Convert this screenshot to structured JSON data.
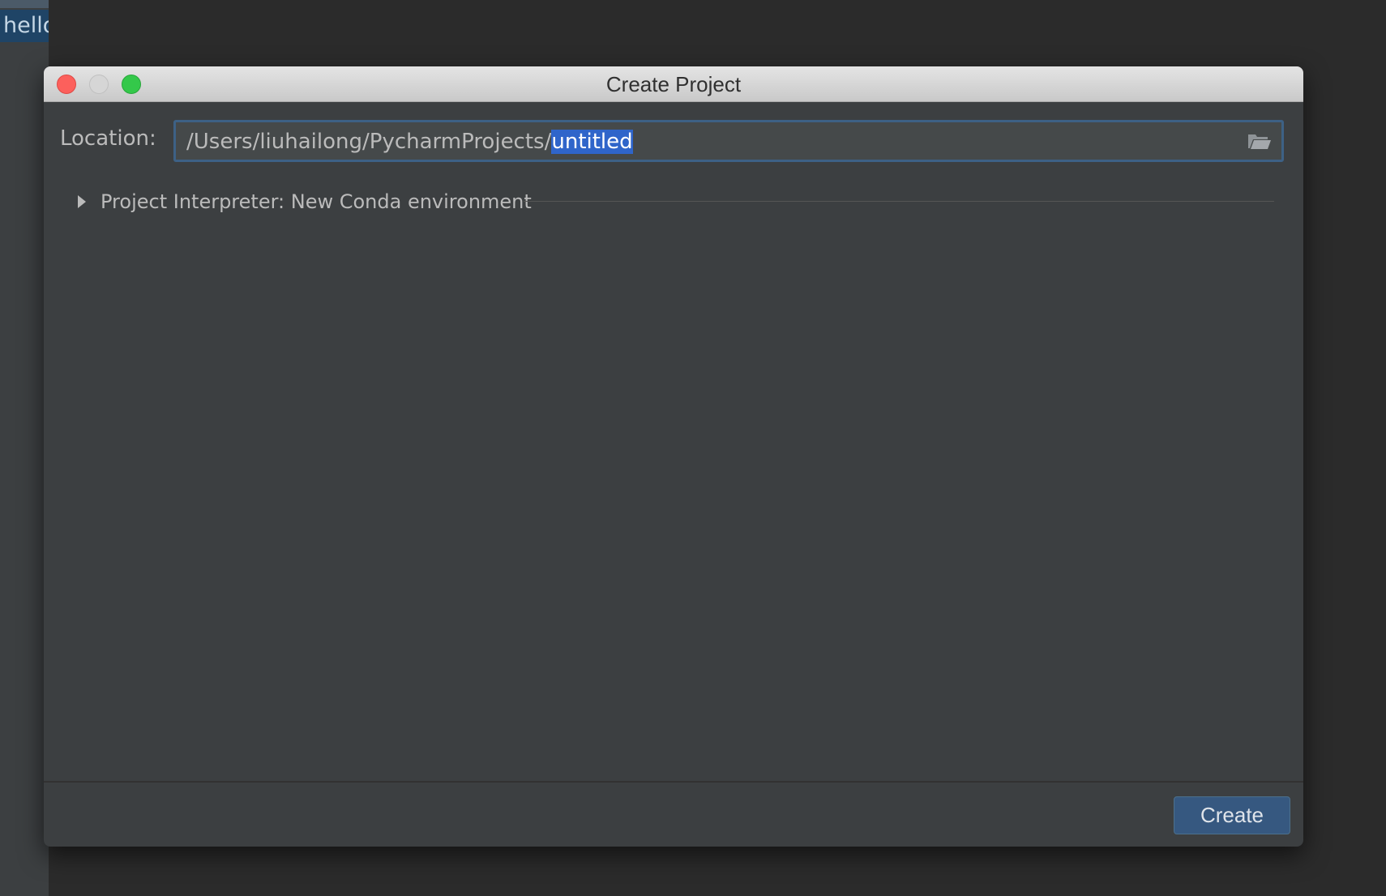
{
  "background": {
    "editor_tab_text": "hello"
  },
  "dialog": {
    "title": "Create Project",
    "location": {
      "label": "Location:",
      "path_prefix": "/Users/liuhailong/PycharmProjects/",
      "path_selected": "untitled"
    },
    "interpreter": {
      "label": "Project Interpreter: New Conda environment",
      "expanded": false
    },
    "footer": {
      "create_label": "Create"
    }
  },
  "icons": {
    "folder": "folder-open-icon",
    "expand": "triangle-right-icon"
  },
  "colors": {
    "selection": "#2f65ca",
    "field_focus_border": "#3d6185",
    "primary_button": "#365880",
    "traffic_close": "#fc605c",
    "traffic_minimize": "#d6d6d6",
    "traffic_zoom": "#34c84a"
  }
}
